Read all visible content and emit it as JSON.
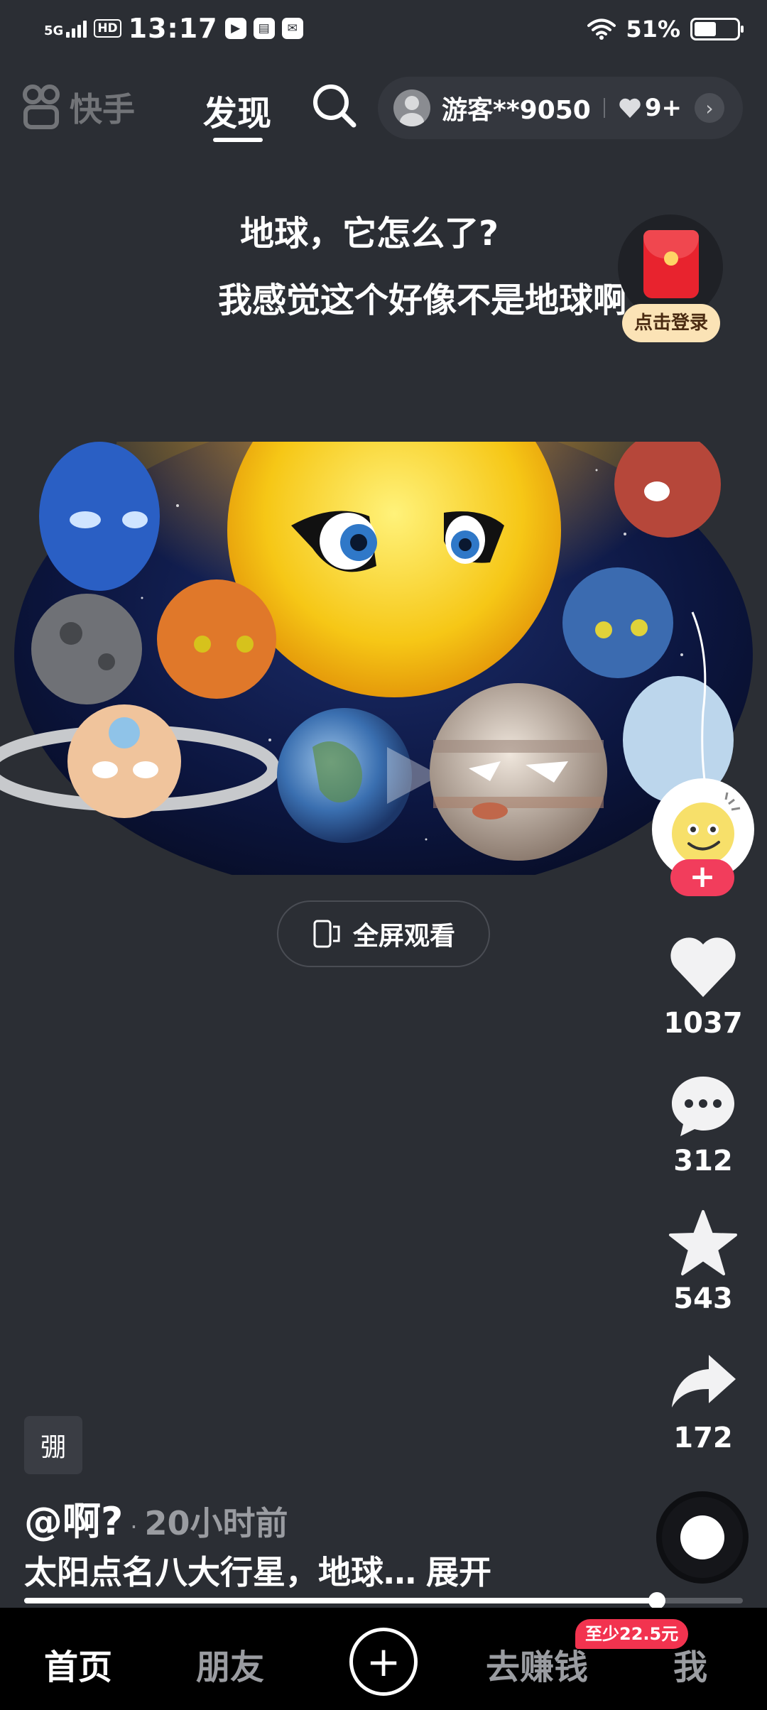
{
  "status_bar": {
    "network": "5G",
    "hd": "HD",
    "time": "13:17",
    "app_icons": [
      "play-icon",
      "book-icon",
      "message-icon"
    ],
    "battery_percent_text": "51%",
    "battery_level": 0.51
  },
  "top_nav": {
    "logo_text": "快手",
    "active_tab": "发现",
    "user_name": "游客**9050",
    "likes_badge": "9+"
  },
  "caption": {
    "line1": "地球，它怎么了?",
    "line2": "我感觉这个好像不是地球啊"
  },
  "login_prompt": "点击登录",
  "fullscreen_label": "全屏观看",
  "actions": {
    "likes": "1037",
    "comments": "312",
    "favorites": "543",
    "shares": "172"
  },
  "post": {
    "tag": "弸",
    "author": "@啊?",
    "time_ago": "20小时前",
    "description": "太阳点名八大行星，地球…",
    "expand_label": "展开",
    "progress": 0.88
  },
  "tab_bar": {
    "home": "首页",
    "friends": "朋友",
    "earn": "去赚钱",
    "earn_badge": "至少22.5元",
    "me": "我"
  },
  "colors": {
    "background": "#2b2e34",
    "accent_red": "#f23d5c",
    "login_badge": "#fbe3b6"
  }
}
